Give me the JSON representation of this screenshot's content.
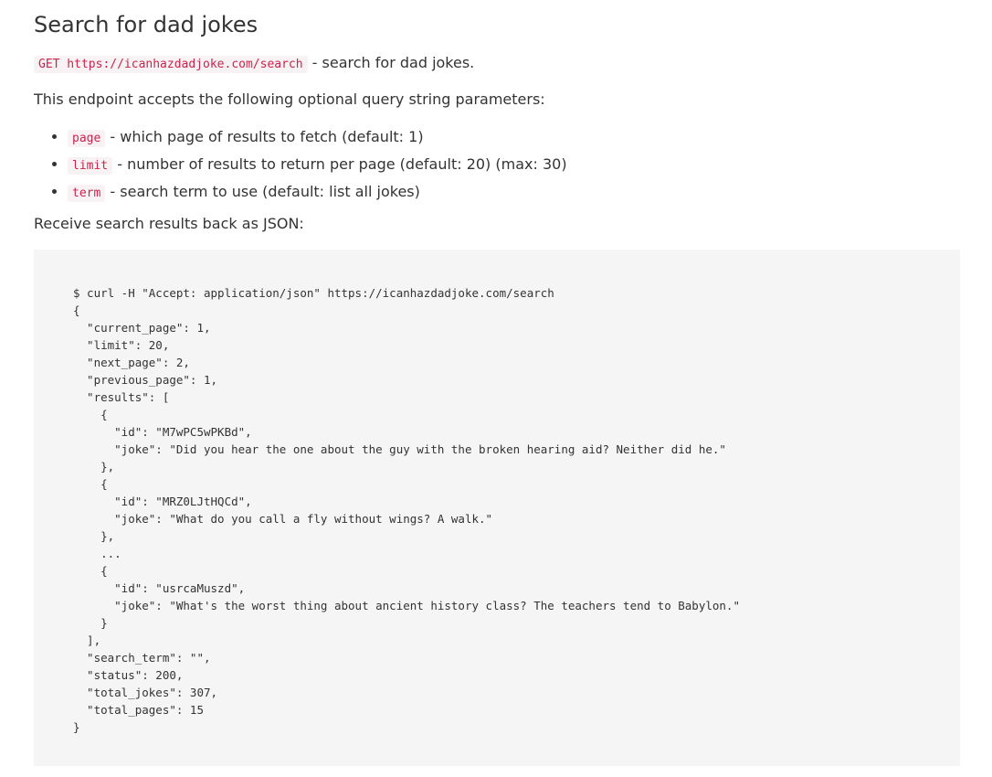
{
  "heading": "Search for dad jokes",
  "endpoint": {
    "method_url": "GET https://icanhazdadjoke.com/search",
    "description": " - search for dad jokes."
  },
  "intro": "This endpoint accepts the following optional query string parameters:",
  "params": [
    {
      "name": "page",
      "description": " - which page of results to fetch (default: 1)"
    },
    {
      "name": "limit",
      "description": " - number of results to return per page (default: 20) (max: 30)"
    },
    {
      "name": "term",
      "description": " - search term to use (default: list all jokes)"
    }
  ],
  "receive_text": "Receive search results back as JSON:",
  "code_sample": "$ curl -H \"Accept: application/json\" https://icanhazdadjoke.com/search\n{\n  \"current_page\": 1,\n  \"limit\": 20,\n  \"next_page\": 2,\n  \"previous_page\": 1,\n  \"results\": [\n    {\n      \"id\": \"M7wPC5wPKBd\",\n      \"joke\": \"Did you hear the one about the guy with the broken hearing aid? Neither did he.\"\n    },\n    {\n      \"id\": \"MRZ0LJtHQCd\",\n      \"joke\": \"What do you call a fly without wings? A walk.\"\n    },\n    ...\n    {\n      \"id\": \"usrcaMuszd\",\n      \"joke\": \"What's the worst thing about ancient history class? The teachers tend to Babylon.\"\n    }\n  ],\n  \"search_term\": \"\",\n  \"status\": 200,\n  \"total_jokes\": 307,\n  \"total_pages\": 15\n}"
}
